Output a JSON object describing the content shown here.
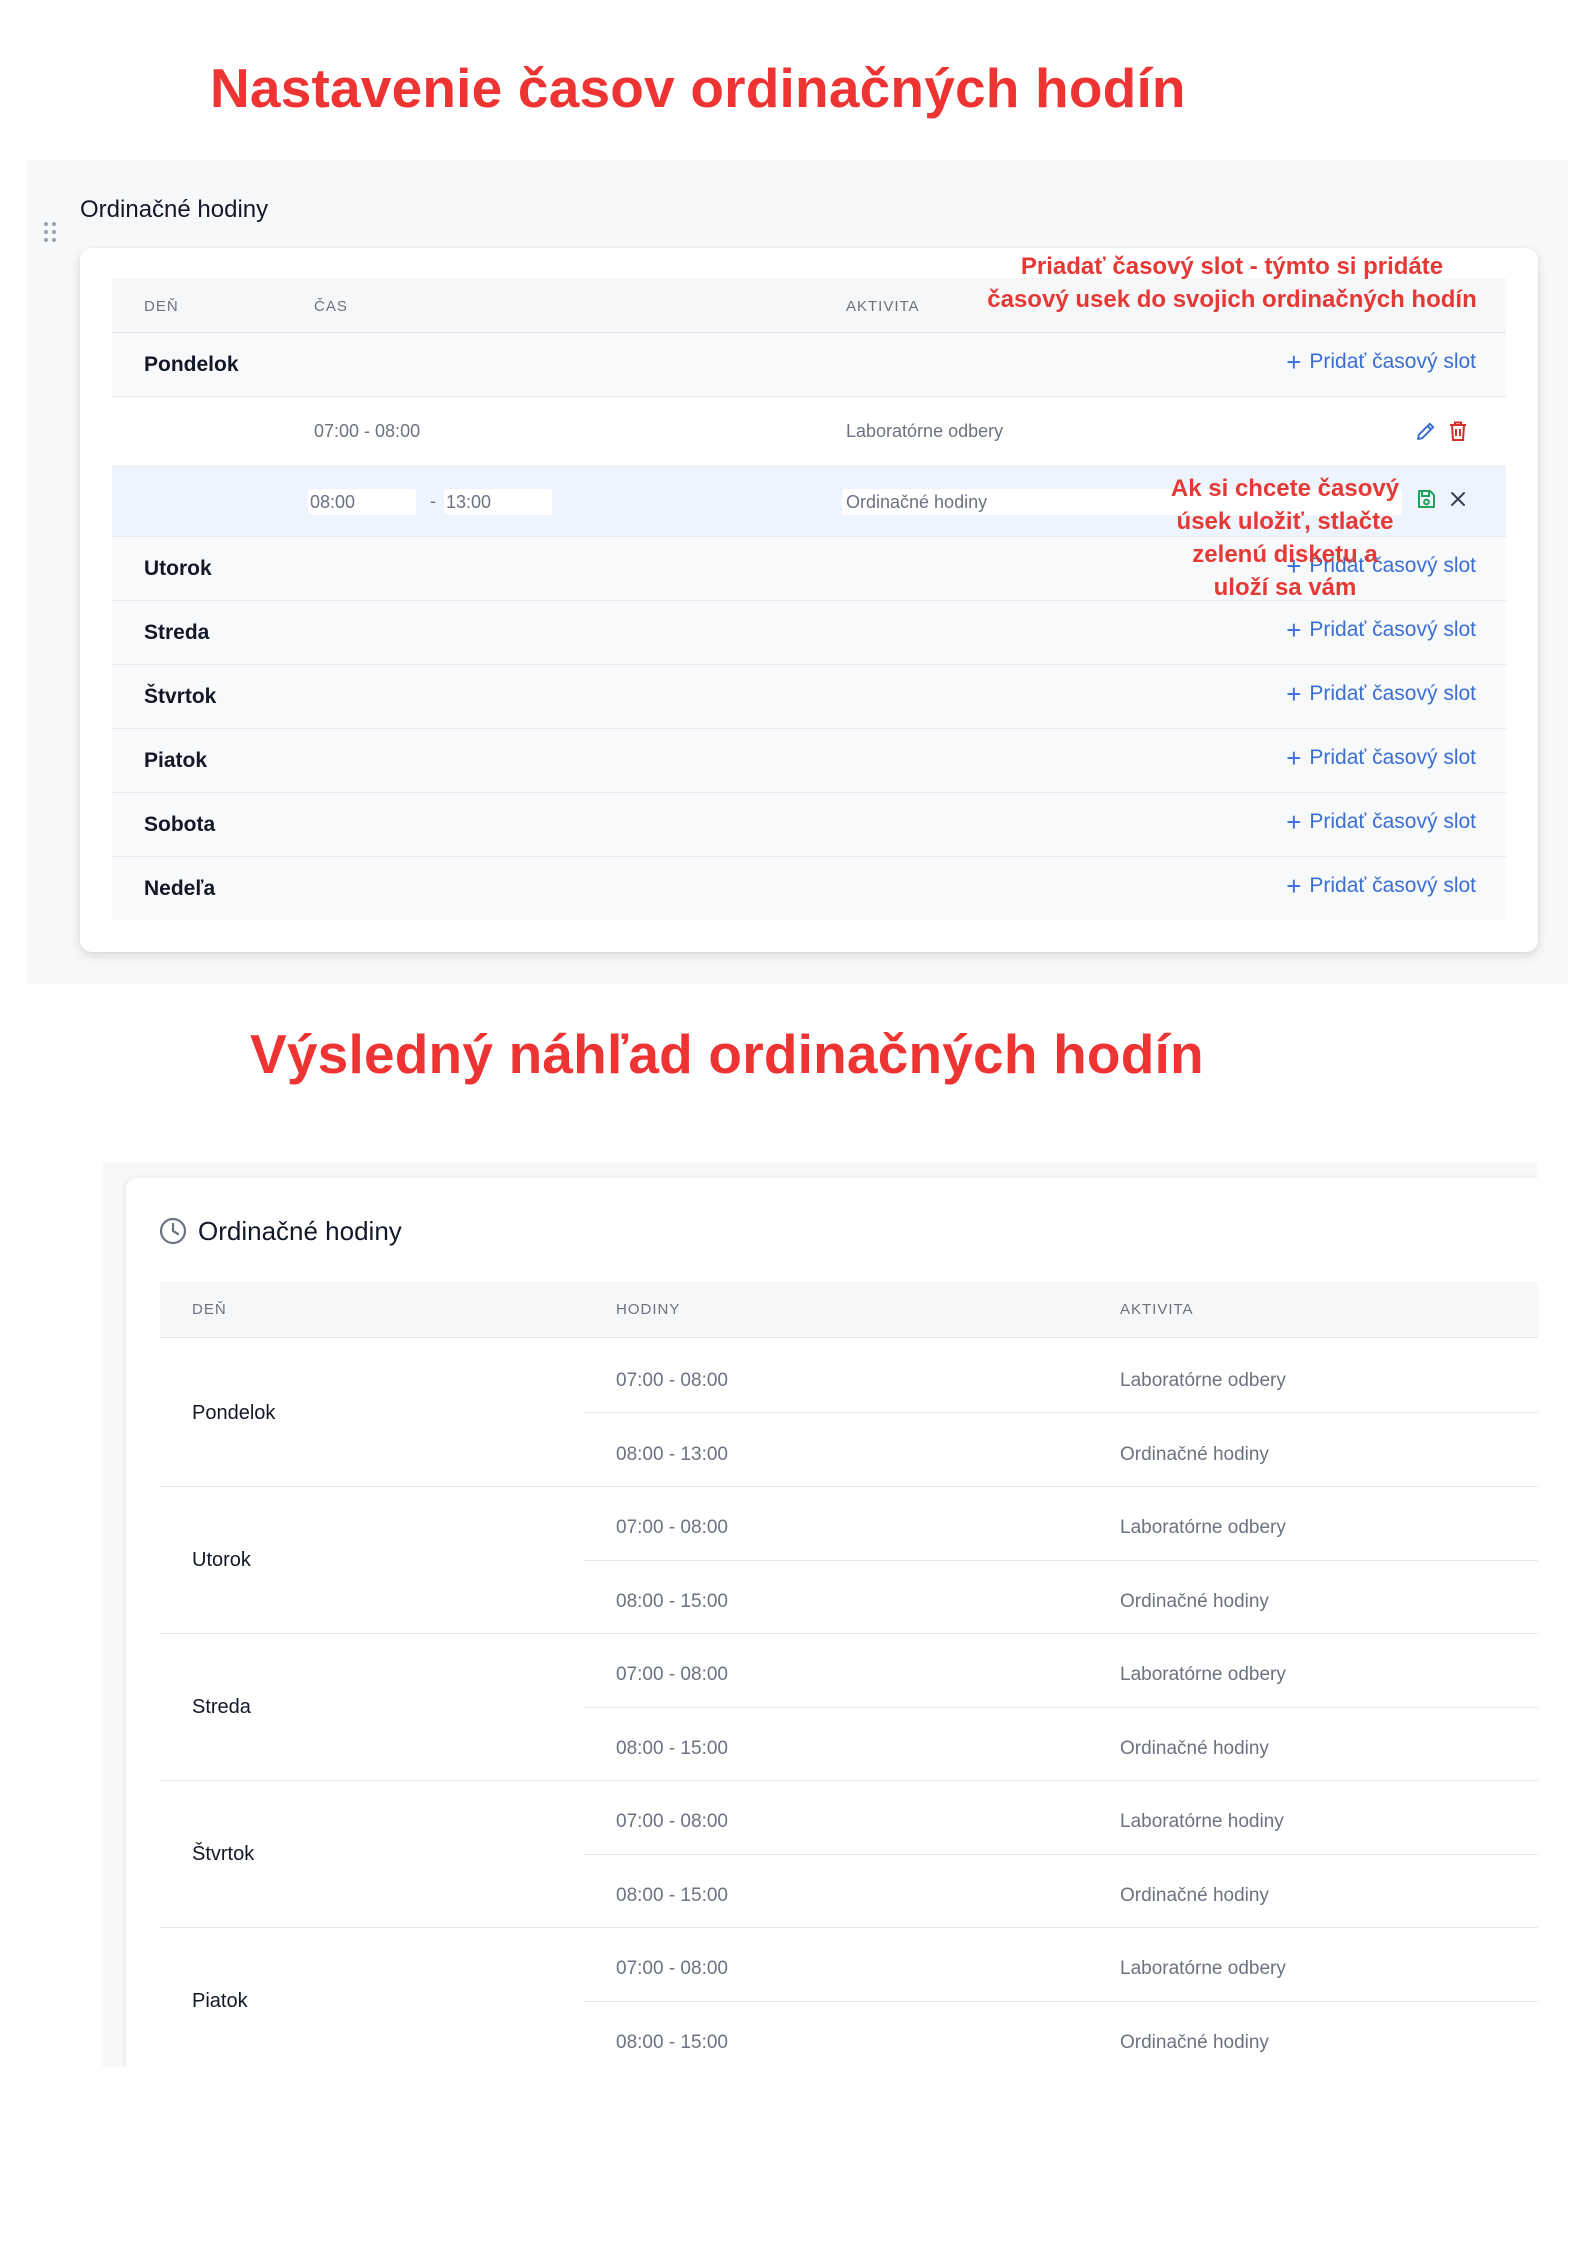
{
  "headings": {
    "setup": "Nastavenie časov ordinačných hodín",
    "preview": "Výsledný náhľad ordinačných hodín"
  },
  "edit": {
    "title": "Ordinačné hodiny",
    "columns": {
      "day": "DEŇ",
      "time": "ČAS",
      "activity": "AKTIVITA"
    },
    "add_label": "Pridať časový slot",
    "days": [
      "Pondelok",
      "Utorok",
      "Streda",
      "Štvrtok",
      "Piatok",
      "Sobota",
      "Nedeľa"
    ],
    "existing_slot": {
      "time": "07:00 - 08:00",
      "activity": "Laboratórne odbery"
    },
    "editing_slot": {
      "from": "08:00",
      "separator": "-",
      "to": "13:00",
      "activity": "Ordinačné hodiny"
    }
  },
  "annotations": {
    "add_hint_line1": "Priadať časový slot - týmto si pridáte",
    "add_hint_line2": "časový usek do svojich ordinačných hodín",
    "save_hint_line1": "Ak si chcete časový",
    "save_hint_line2": "úsek uložiť, stlačte",
    "save_hint_line3": "zelenú disketu a",
    "save_hint_line4": "uloží sa vám"
  },
  "preview": {
    "title": "Ordinačné hodiny",
    "columns": {
      "day": "DEŇ",
      "hours": "HODINY",
      "activity": "AKTIVITA"
    },
    "days": [
      {
        "name": "Pondelok",
        "slots": [
          {
            "time": "07:00 - 08:00",
            "activity": "Laboratórne odbery"
          },
          {
            "time": "08:00 - 13:00",
            "activity": "Ordinačné hodiny"
          }
        ]
      },
      {
        "name": "Utorok",
        "slots": [
          {
            "time": "07:00 - 08:00",
            "activity": "Laboratórne odbery"
          },
          {
            "time": "08:00 - 15:00",
            "activity": "Ordinačné hodiny"
          }
        ]
      },
      {
        "name": "Streda",
        "slots": [
          {
            "time": "07:00 - 08:00",
            "activity": "Laboratórne odbery"
          },
          {
            "time": "08:00 - 15:00",
            "activity": "Ordinačné hodiny"
          }
        ]
      },
      {
        "name": "Štvrtok",
        "slots": [
          {
            "time": "07:00 - 08:00",
            "activity": "Laboratórne hodiny"
          },
          {
            "time": "08:00 - 15:00",
            "activity": "Ordinačné hodiny"
          }
        ]
      },
      {
        "name": "Piatok",
        "slots": [
          {
            "time": "07:00 - 08:00",
            "activity": "Laboratórne odbery"
          },
          {
            "time": "08:00 - 15:00",
            "activity": "Ordinačné hodiny"
          }
        ]
      }
    ]
  },
  "colors": {
    "annotation": "#e53935",
    "heading": "#ee3333",
    "link": "#3b6fd1",
    "save": "#22a35a",
    "delete": "#d32f2f"
  },
  "icons": {
    "drag": "drag-handle-icon",
    "edit": "pencil-icon",
    "delete": "trash-icon",
    "save": "floppy-disk-icon",
    "cancel": "close-icon",
    "clock": "clock-icon",
    "add": "plus-icon"
  }
}
